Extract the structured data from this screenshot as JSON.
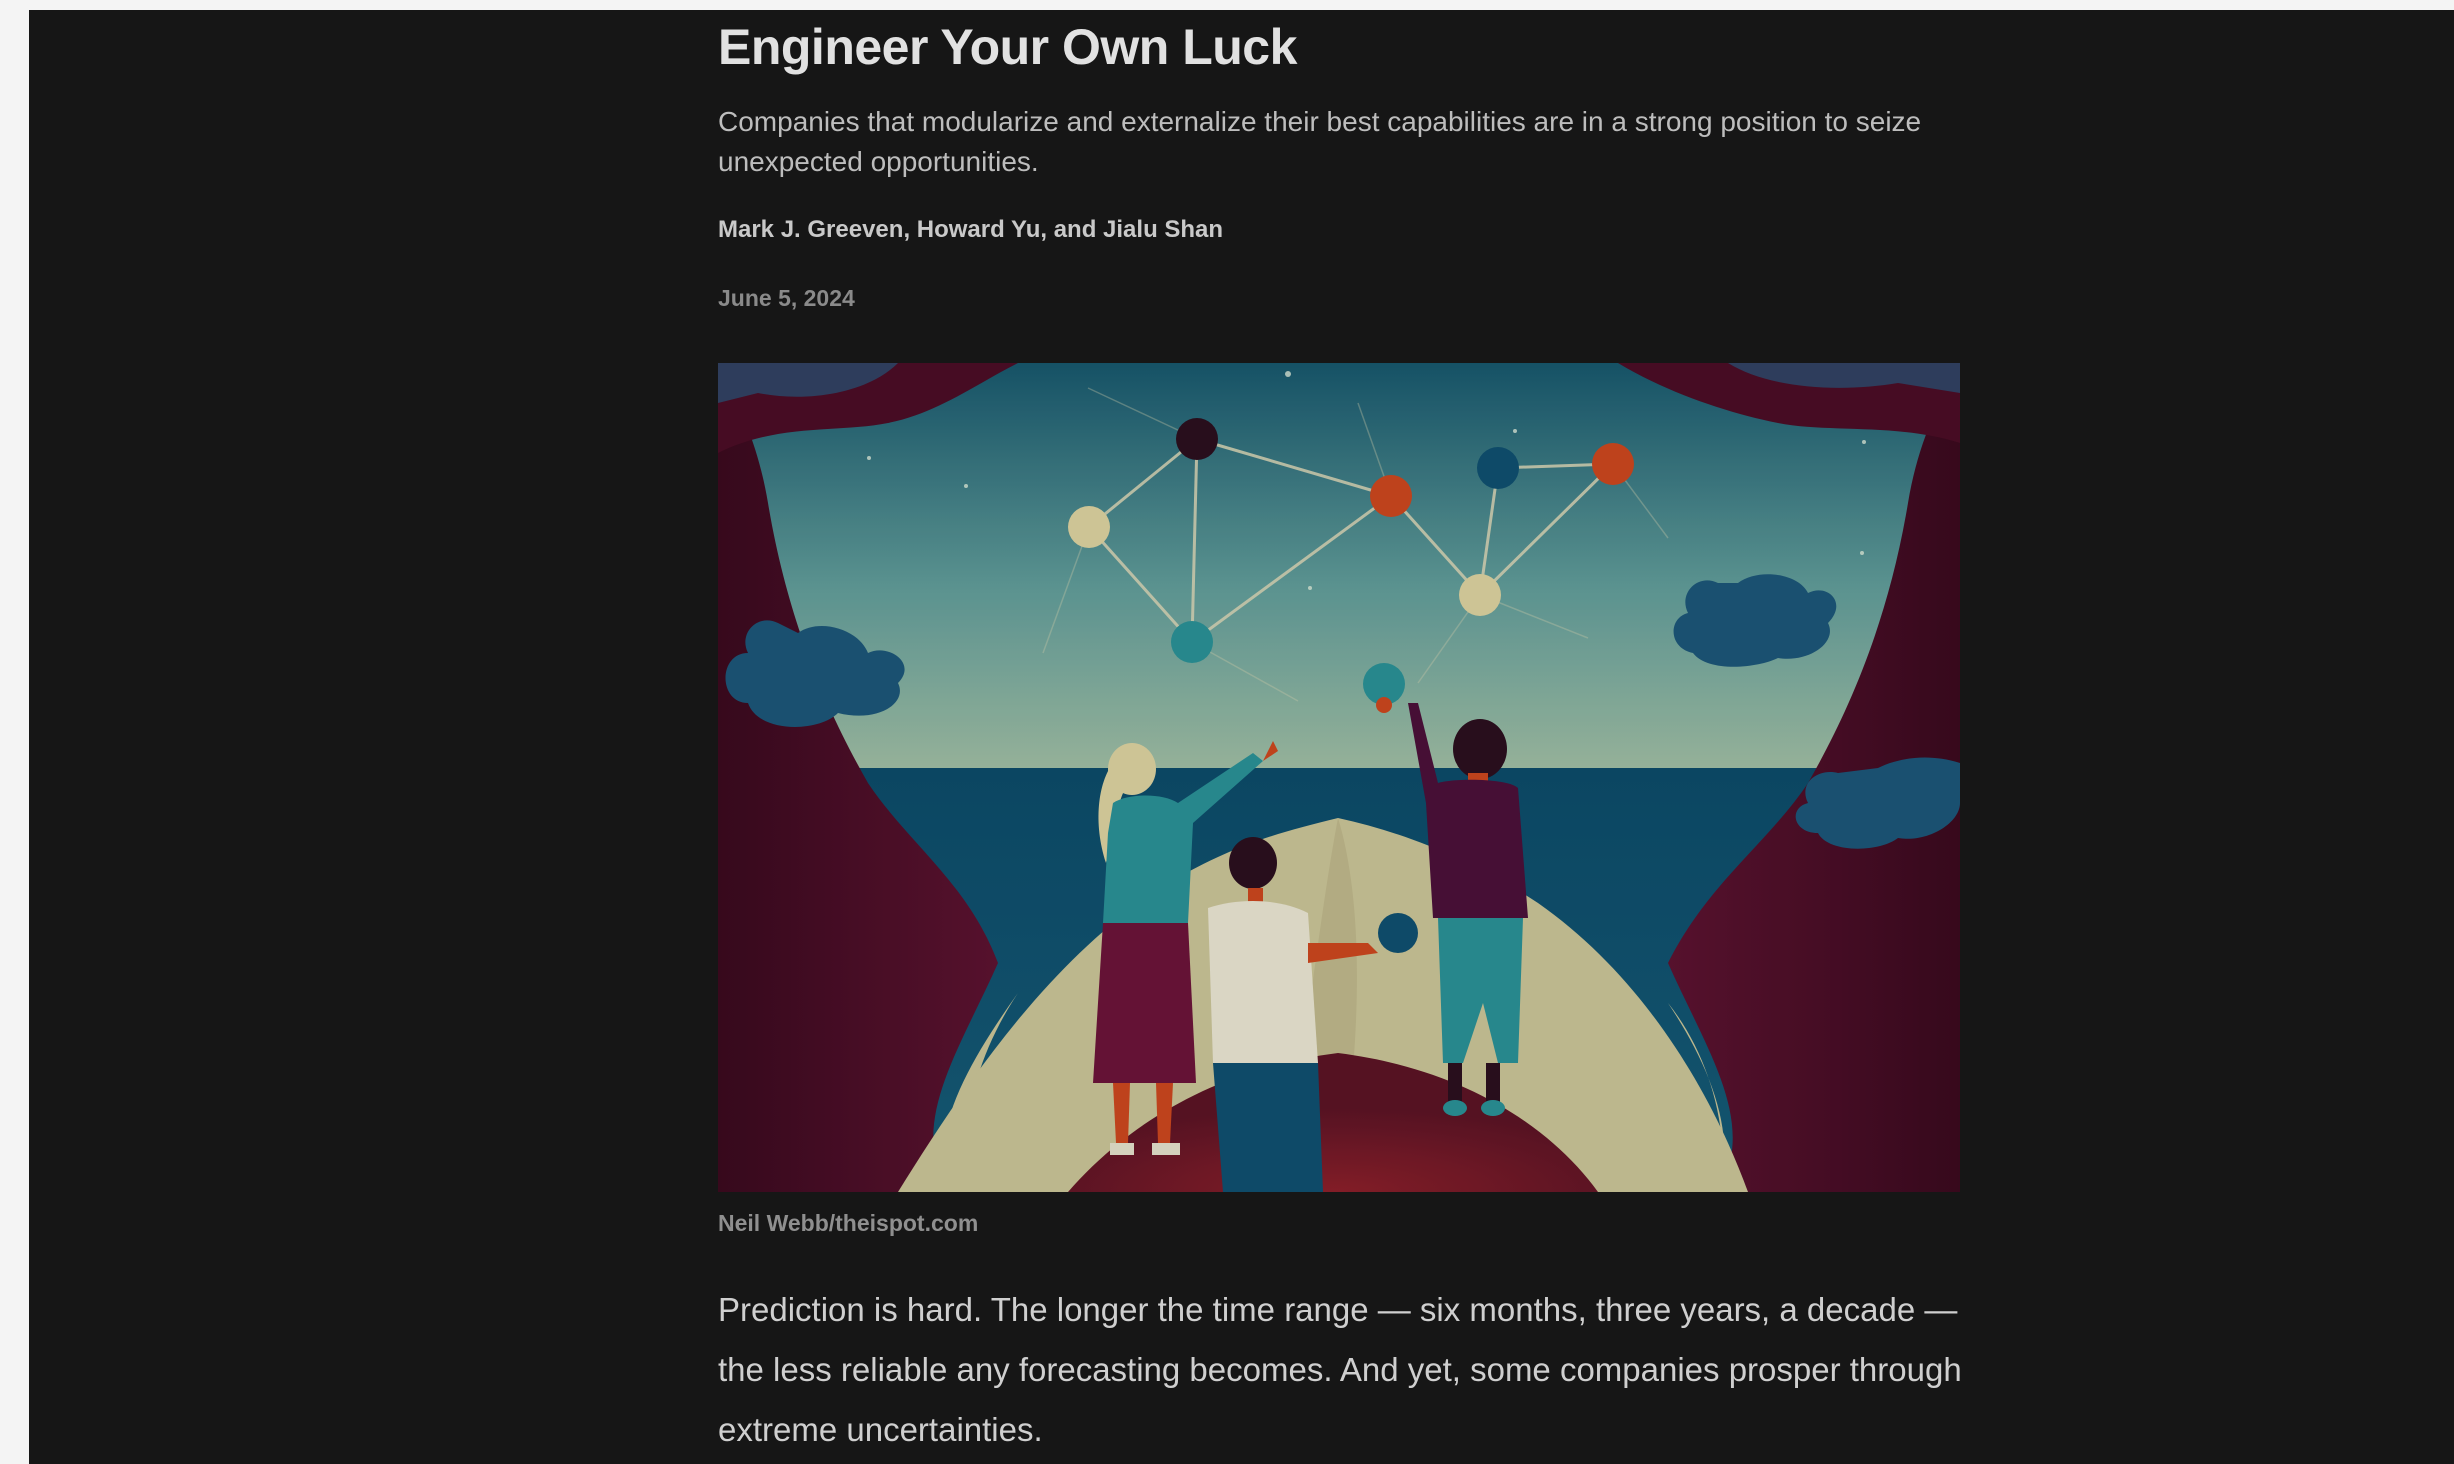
{
  "article": {
    "title": "Engineer Your Own Luck",
    "dek": "Companies that modularize and externalize their best capabilities are in a strong position to seize unexpected opportunities.",
    "authors": "Mark J. Greeven, Howard Yu, and Jialu Shan",
    "date": "June 5, 2024",
    "image_credit": "Neil Webb/theispot.com",
    "first_paragraph": "Prediction is hard. The longer the time range — six months, three years, a decade — the less reliable any forecasting becomes. And yet, some companies prosper through extreme uncertainties."
  },
  "colors": {
    "page_background": "#161616",
    "outer_background": "#f4f4f4",
    "title": "#e1e1e1",
    "sky_top": "#1d5f72",
    "sky_bottom": "#8fb3a0",
    "sea": "#0f4f6e",
    "cliff": "#4a0d25",
    "sand": "#c7c195",
    "orange_node": "#c9461e",
    "teal_node": "#2a8f94",
    "cream_node": "#d8cf9e",
    "dark_node": "#2b0f1e"
  },
  "illustration": {
    "subject": "three people on a cliff reaching toward a constellation of connected spheres over the sea"
  }
}
